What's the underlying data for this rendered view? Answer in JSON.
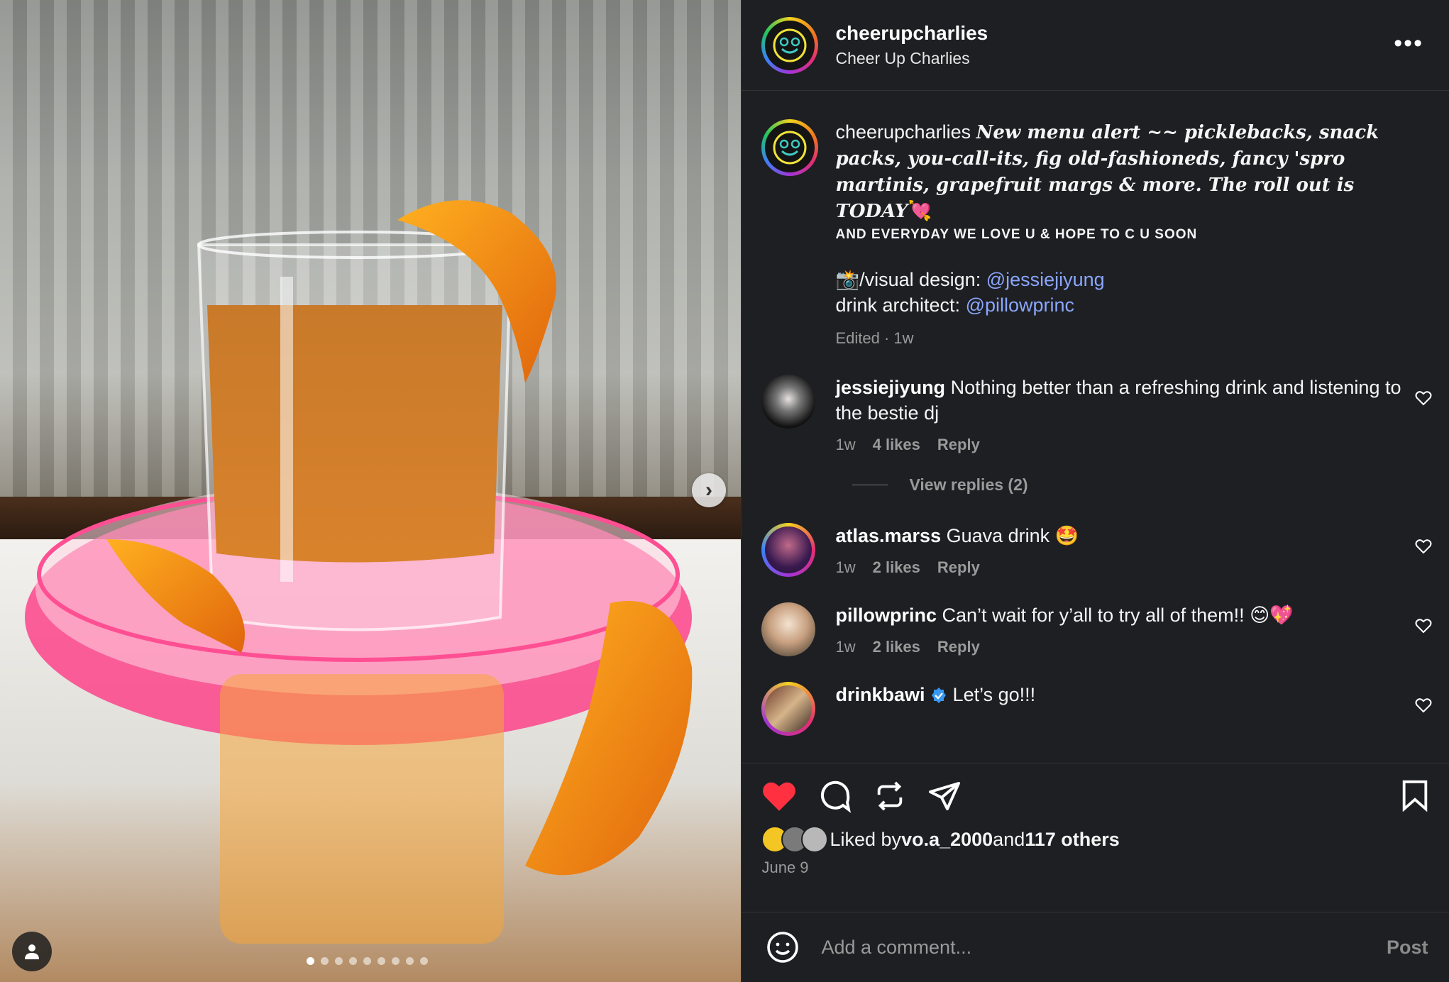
{
  "post": {
    "username": "cheerupcharlies",
    "full_name": "Cheer Up Charlies",
    "more_icon": "•••",
    "caption": {
      "username": "cheerupcharlies",
      "line1": "New menu alert ~~ picklebacks, snack packs, you-call-its, fig old-fashioneds, fancy 'spro martinis, grapefruit margs & more. The roll out is TODAY",
      "emoji1": "💘",
      "line2": "AND EVERYDAY WE LOVE U & HOPE TO C U SOON",
      "credit1_prefix": "📸/visual design: ",
      "credit1_link": "@jessiejiyung",
      "credit2_prefix": "drink architect: ",
      "credit2_link": "@pillowprinc",
      "meta": "Edited · 1w"
    }
  },
  "comments": [
    {
      "user": "jessiejiyung",
      "text": "Nothing better than a refreshing drink and listening to the bestie dj",
      "age": "1w",
      "likes": "4 likes",
      "reply": "Reply"
    },
    {
      "user": "atlas.marss",
      "text": "Guava drink 🤩",
      "age": "1w",
      "likes": "2 likes",
      "reply": "Reply"
    },
    {
      "user": "pillowprinc",
      "text": "Can’t wait for y’all to try all of them!! 😊💖",
      "age": "1w",
      "likes": "2 likes",
      "reply": "Reply"
    },
    {
      "user": "drinkbawi",
      "text": "Let’s go!!!",
      "verified": true
    }
  ],
  "view_replies": "View replies (2)",
  "likes": {
    "prefix": "Liked by ",
    "user": "vo.a_2000",
    "middle": " and ",
    "others": "117 others"
  },
  "date": "June 9",
  "add_comment": {
    "placeholder": "Add a comment...",
    "post": "Post"
  },
  "carousel": {
    "count": 9,
    "active": 0
  },
  "colors": {
    "panel_bg": "#1e1f22",
    "link": "#8aa6ff",
    "heart": "#ff3040"
  }
}
